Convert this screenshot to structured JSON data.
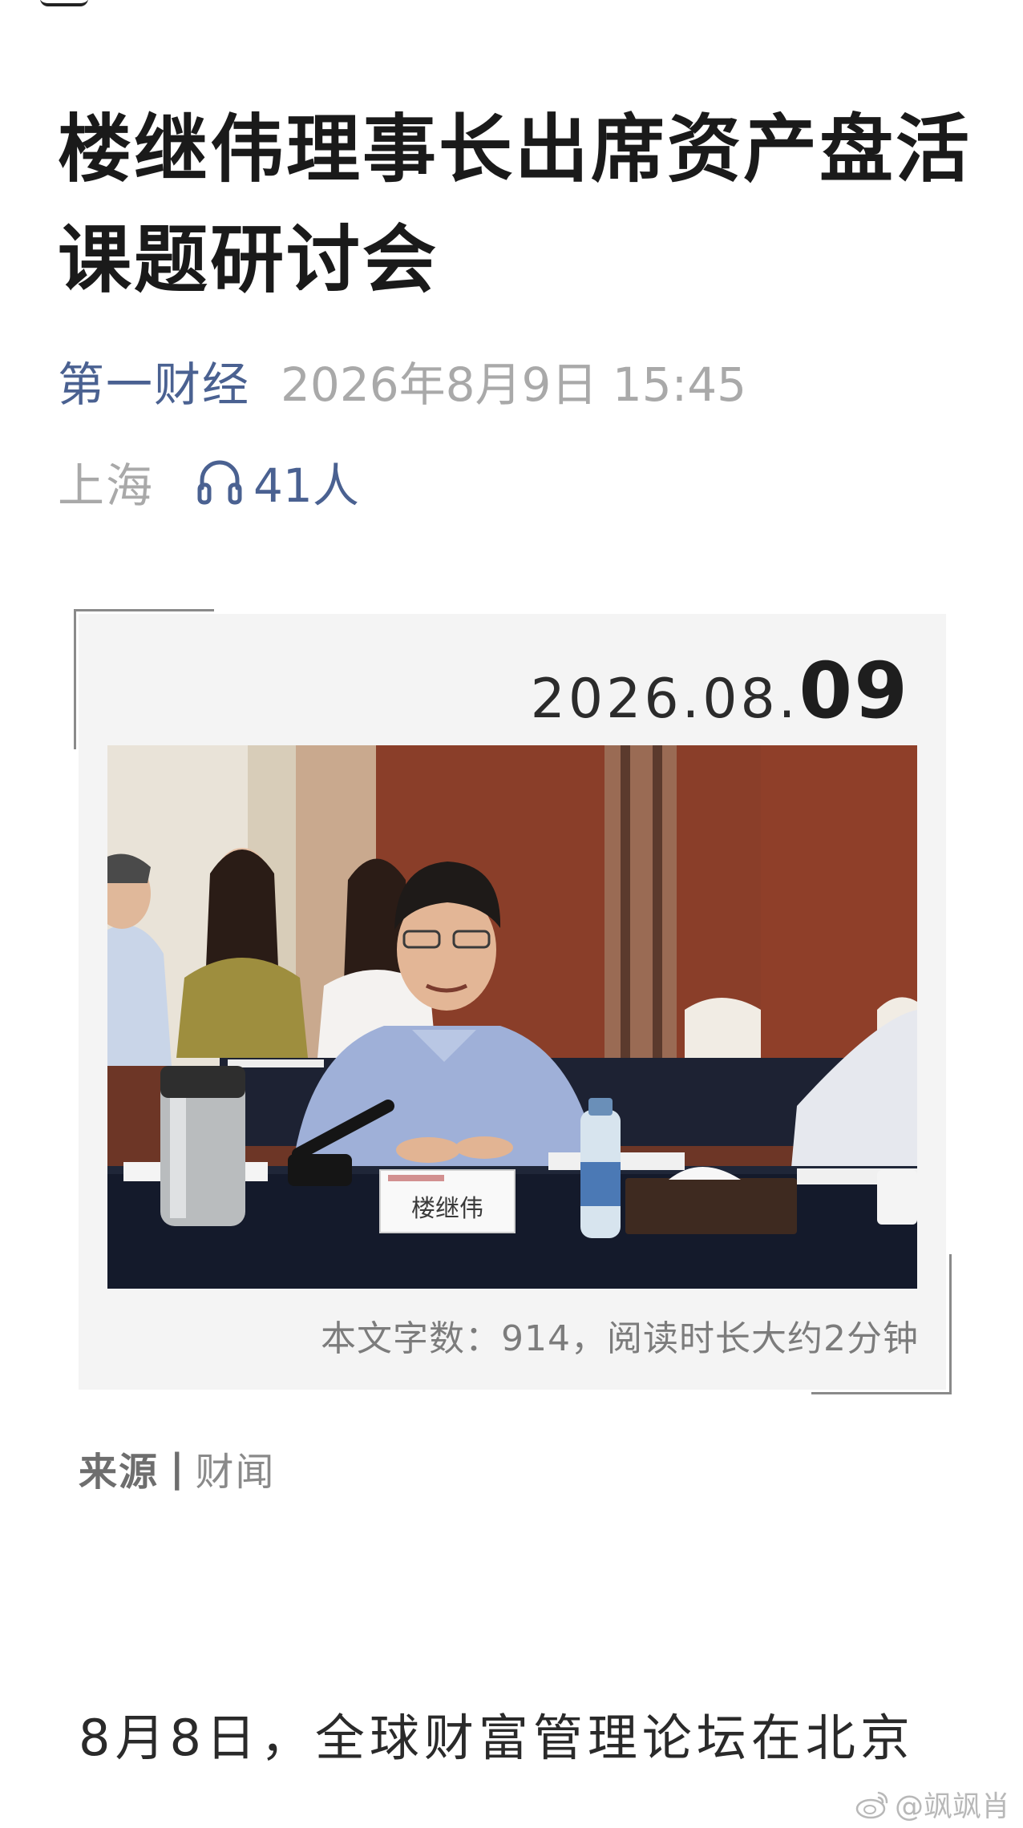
{
  "article": {
    "title": "楼继伟理事长出席资产盘活课题研讨会",
    "source_name": "第一财经",
    "publish_time": "2026年8月9日 15:45",
    "location": "上海",
    "listeners": "41人"
  },
  "card": {
    "date_prefix": "2026.08.",
    "date_day": "09",
    "nameplate": "楼继伟",
    "stats": "本文字数：914，阅读时长大约2分钟"
  },
  "source": {
    "label": "来源",
    "separator": "|",
    "value": "财闻"
  },
  "body": {
    "first_line": "8月8日，全球财富管理论坛在北京"
  },
  "watermark": {
    "text": "@飒飒肖"
  },
  "icons": [
    "headphones-icon",
    "weibo-icon"
  ],
  "colors": {
    "accent": "#4a6191",
    "muted": "#a9a9a9",
    "card_bg": "#f4f4f4"
  }
}
